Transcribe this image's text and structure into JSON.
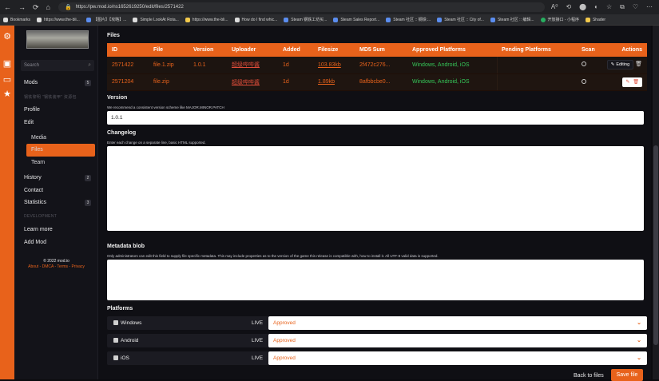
{
  "browser": {
    "url": "https://pw.mod.io/ns1652619250/edit/files/2571422",
    "nav_back": "←",
    "nav_forward": "→",
    "nav_reload": "⟳",
    "nav_home": "⌂",
    "tools": [
      "A⁰",
      "⟲",
      "⬤",
      "◐",
      "☆",
      "⧉",
      "♡",
      "⋯"
    ]
  },
  "bookmarks": [
    {
      "label": "Bookmarks",
      "icon": "w"
    },
    {
      "label": "https://www.the-bli...",
      "icon": "w"
    },
    {
      "label": "【图片】【攻略】...",
      "icon": ""
    },
    {
      "label": "Simple LookAt Rota...",
      "icon": "w"
    },
    {
      "label": "https://www.the-bli...",
      "icon": "y"
    },
    {
      "label": "How do I find whic...",
      "icon": "w"
    },
    {
      "label": "Steam 钢铁工坊买...",
      "icon": ""
    },
    {
      "label": "Steam Sales Report...",
      "icon": ""
    },
    {
      "label": "Steam 社区 :: 钢铁:...",
      "icon": ""
    },
    {
      "label": "Steam 社区 :: City of...",
      "icon": ""
    },
    {
      "label": "Steam 社区 :: 编辑...",
      "icon": ""
    },
    {
      "label": "开放接口 - 小程序",
      "icon": "g"
    },
    {
      "label": "Shader",
      "icon": "y"
    }
  ],
  "sidebar": {
    "search_placeholder": "Search",
    "mods_label": "Mods",
    "mods_count": "5",
    "faded_line": "钢铁黎明 \"钢铁装甲\" 资源包",
    "profile": "Profile",
    "edit": "Edit",
    "media": "Media",
    "files": "Files",
    "team": "Team",
    "history": "History",
    "history_count": "2",
    "contact": "Contact",
    "statistics": "Statistics",
    "statistics_count": "3",
    "development": "DEVELOPMENT",
    "learn_more": "Learn more",
    "add_mod": "Add Mod",
    "copyright": "© 2022 mod.io",
    "footer_links": "About - DMCA - Terms - Privacy"
  },
  "files_section": {
    "title": "Files",
    "columns": [
      "ID",
      "File",
      "Version",
      "Uploader",
      "Added",
      "Filesize",
      "MD5 Sum",
      "Approved Platforms",
      "Pending Platforms",
      "Scan",
      "Actions"
    ],
    "rows": [
      {
        "id": "2571422",
        "file": "file.1.zip",
        "version": "1.0.1",
        "uploader": "超级哔哔酱",
        "added": "1d",
        "filesize": "103.83kb",
        "md5": "2f472c276...",
        "approved": "Windows, Android, iOS",
        "pending": "",
        "action": "Editing"
      },
      {
        "id": "2571204",
        "file": "file.zip",
        "version": "",
        "uploader": "超级哔哔酱",
        "added": "1d",
        "filesize": "1.89kb",
        "md5": "8afbbcbe0...",
        "approved": "Windows, Android, iOS",
        "pending": "",
        "action": ""
      }
    ]
  },
  "version": {
    "title": "Version",
    "hint": "We recommend a consistent version scheme like MAJOR.MINOR.PATCH",
    "value": "1.0.1"
  },
  "changelog": {
    "title": "Changelog",
    "hint": "Enter each change on a separate line, basic HTML supported."
  },
  "metadata": {
    "title": "Metadata blob",
    "hint": "Only administrators can edit this field to supply file specific metadata. This may include properties as to the version of the game this release is compatible with, how to install it. All UTF-8 valid data is supported."
  },
  "platforms": {
    "title": "Platforms",
    "rows": [
      {
        "name": "Windows",
        "live": "LIVE",
        "status": "Approved"
      },
      {
        "name": "Android",
        "live": "LIVE",
        "status": "Approved"
      },
      {
        "name": "iOS",
        "live": "LIVE",
        "status": "Approved"
      }
    ]
  },
  "footer": {
    "back": "Back to files",
    "save": "Save file"
  }
}
